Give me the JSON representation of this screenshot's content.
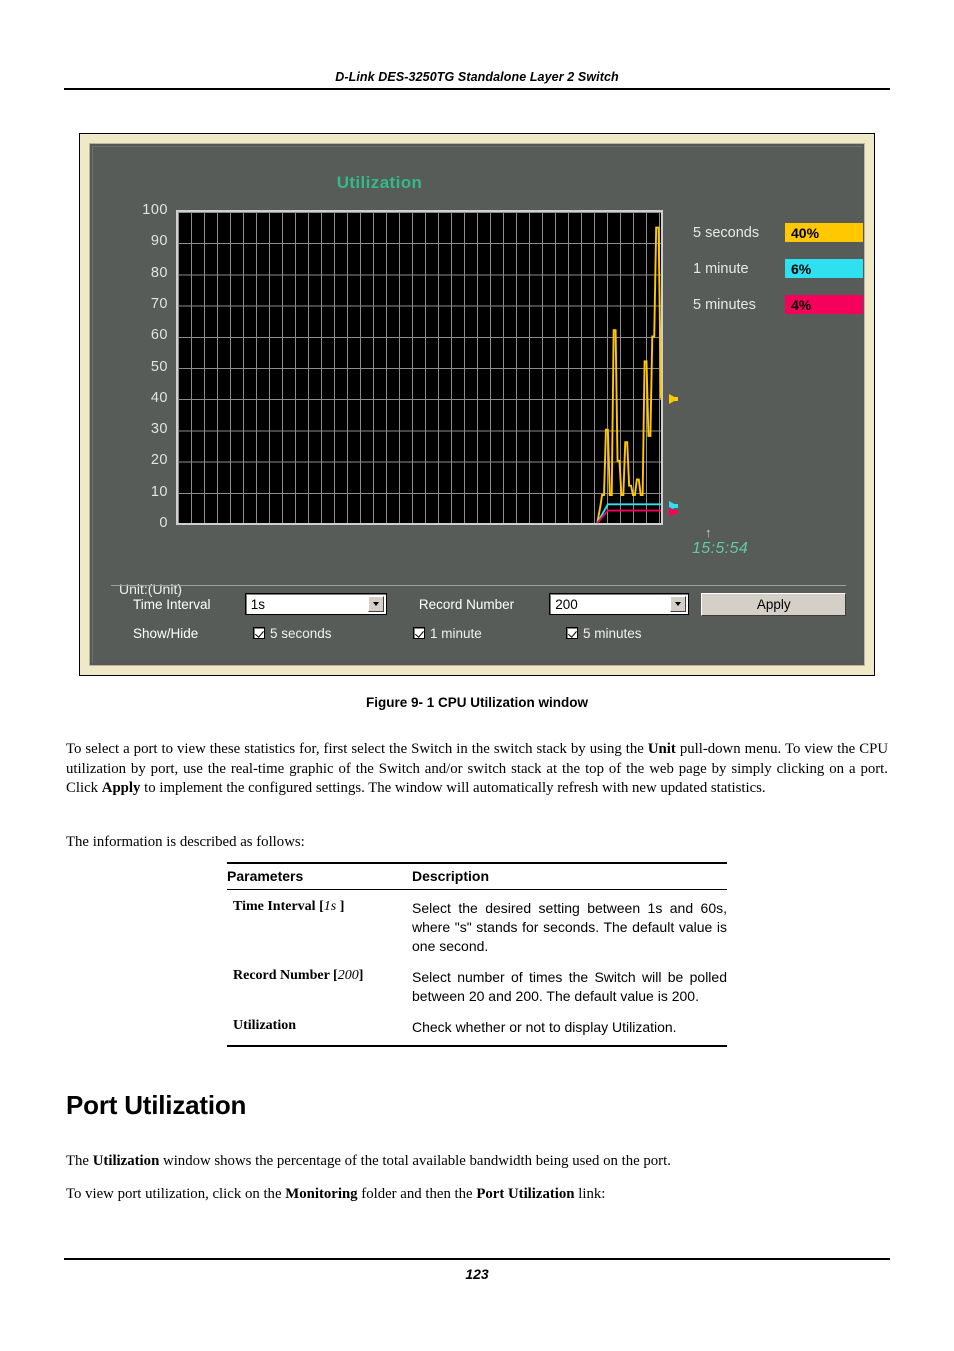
{
  "page": {
    "running_header": "D-Link DES-3250TG Standalone Layer 2 Switch",
    "page_number": "123"
  },
  "figure": {
    "caption": "Figure 9- 1 CPU Utilization window",
    "window": {
      "chart_title": "Utilization",
      "unit_label": "Unit:(Unit)",
      "time_label": "15:5:54",
      "controls": {
        "time_interval_label": "Time Interval",
        "time_interval_value": "1s",
        "record_number_label": "Record Number",
        "record_number_value": "200",
        "apply_label": "Apply",
        "show_hide_label": "Show/Hide",
        "checkboxes": [
          {
            "label": "5 seconds",
            "checked": true
          },
          {
            "label": "1 minute",
            "checked": true
          },
          {
            "label": "5 minutes",
            "checked": true
          }
        ]
      }
    }
  },
  "chart_data": {
    "type": "line",
    "title": "Utilization",
    "xlabel": "",
    "ylabel": "",
    "ylim": [
      0,
      100
    ],
    "yticks": [
      100,
      90,
      80,
      70,
      60,
      50,
      40,
      30,
      20,
      10,
      0
    ],
    "grid": true,
    "legend_position": "right",
    "x_annotation": "15:5:54",
    "legend": [
      {
        "name": "5 seconds",
        "value": "40%",
        "numeric": 40,
        "color": "#ffc800"
      },
      {
        "name": "1 minute",
        "value": "6%",
        "numeric": 6,
        "color": "#2ee0f0"
      },
      {
        "name": "5 minutes",
        "value": "4%",
        "numeric": 4,
        "color": "#f5005a"
      }
    ],
    "series": [
      {
        "name": "5 seconds",
        "color": "#ffc800",
        "x": [
          0.868,
          0.874,
          0.878,
          0.882,
          0.886,
          0.89,
          0.894,
          0.898,
          0.902,
          0.906,
          0.91,
          0.914,
          0.918,
          0.922,
          0.926,
          0.93,
          0.934,
          0.938,
          0.942,
          0.946,
          0.95,
          0.954,
          0.958,
          0.962,
          0.966,
          0.97,
          0.974,
          0.978,
          0.982,
          0.986,
          0.99,
          0.995,
          1.0
        ],
        "values": [
          0,
          5,
          9,
          9,
          30,
          30,
          9,
          9,
          62,
          62,
          20,
          20,
          9,
          9,
          26,
          26,
          12,
          12,
          9,
          9,
          14,
          14,
          9,
          9,
          52,
          52,
          28,
          28,
          60,
          60,
          95,
          95,
          40
        ]
      },
      {
        "name": "1 minute",
        "color": "#2ee0f0",
        "x": [
          0.868,
          0.89,
          0.92,
          0.95,
          1.0
        ],
        "values": [
          0,
          6,
          6,
          6,
          6
        ]
      },
      {
        "name": "5 minutes",
        "color": "#f5005a",
        "x": [
          0.868,
          0.89,
          0.92,
          0.95,
          1.0
        ],
        "values": [
          0,
          4,
          4,
          4,
          4
        ]
      }
    ]
  },
  "body": {
    "para1_html": "To select a port to view these statistics for, first select the Switch in the switch stack by using the <b class=\"bd\">Unit</b> pull-down menu. To view the CPU utilization by port, use the real-time graphic of the Switch and/or switch stack at the top of the web page by simply clicking on a port. Click <b class=\"bd\">Apply</b> to implement the configured settings. The window will automatically refresh with new updated statistics.",
    "para2_html": "The information is described as follows:",
    "section_title": "Port Utilization",
    "para3_html": "The <b class=\"bd\">Utilization</b> window shows the percentage of the total available bandwidth being used on the port.",
    "para4_html": "To view port utilization, click on the <b class=\"bd\">Monitoring</b> folder and then the <b class=\"bd\">Port Utilization</b> link:"
  },
  "params_table": {
    "headers": [
      "Parameters",
      "Description"
    ],
    "rows": [
      {
        "param_html": "Time Interval [<em>1s</em> ]",
        "description": "Select the desired setting between 1s and 60s, where \"s\" stands for seconds. The default value is one second."
      },
      {
        "param_html": "Record Number [<em>200</em>]",
        "description": "Select number of times the Switch will be polled between 20 and 200. The default value is 200."
      },
      {
        "param_html": "Utilization",
        "description": "Check whether or not to display Utilization."
      }
    ]
  }
}
